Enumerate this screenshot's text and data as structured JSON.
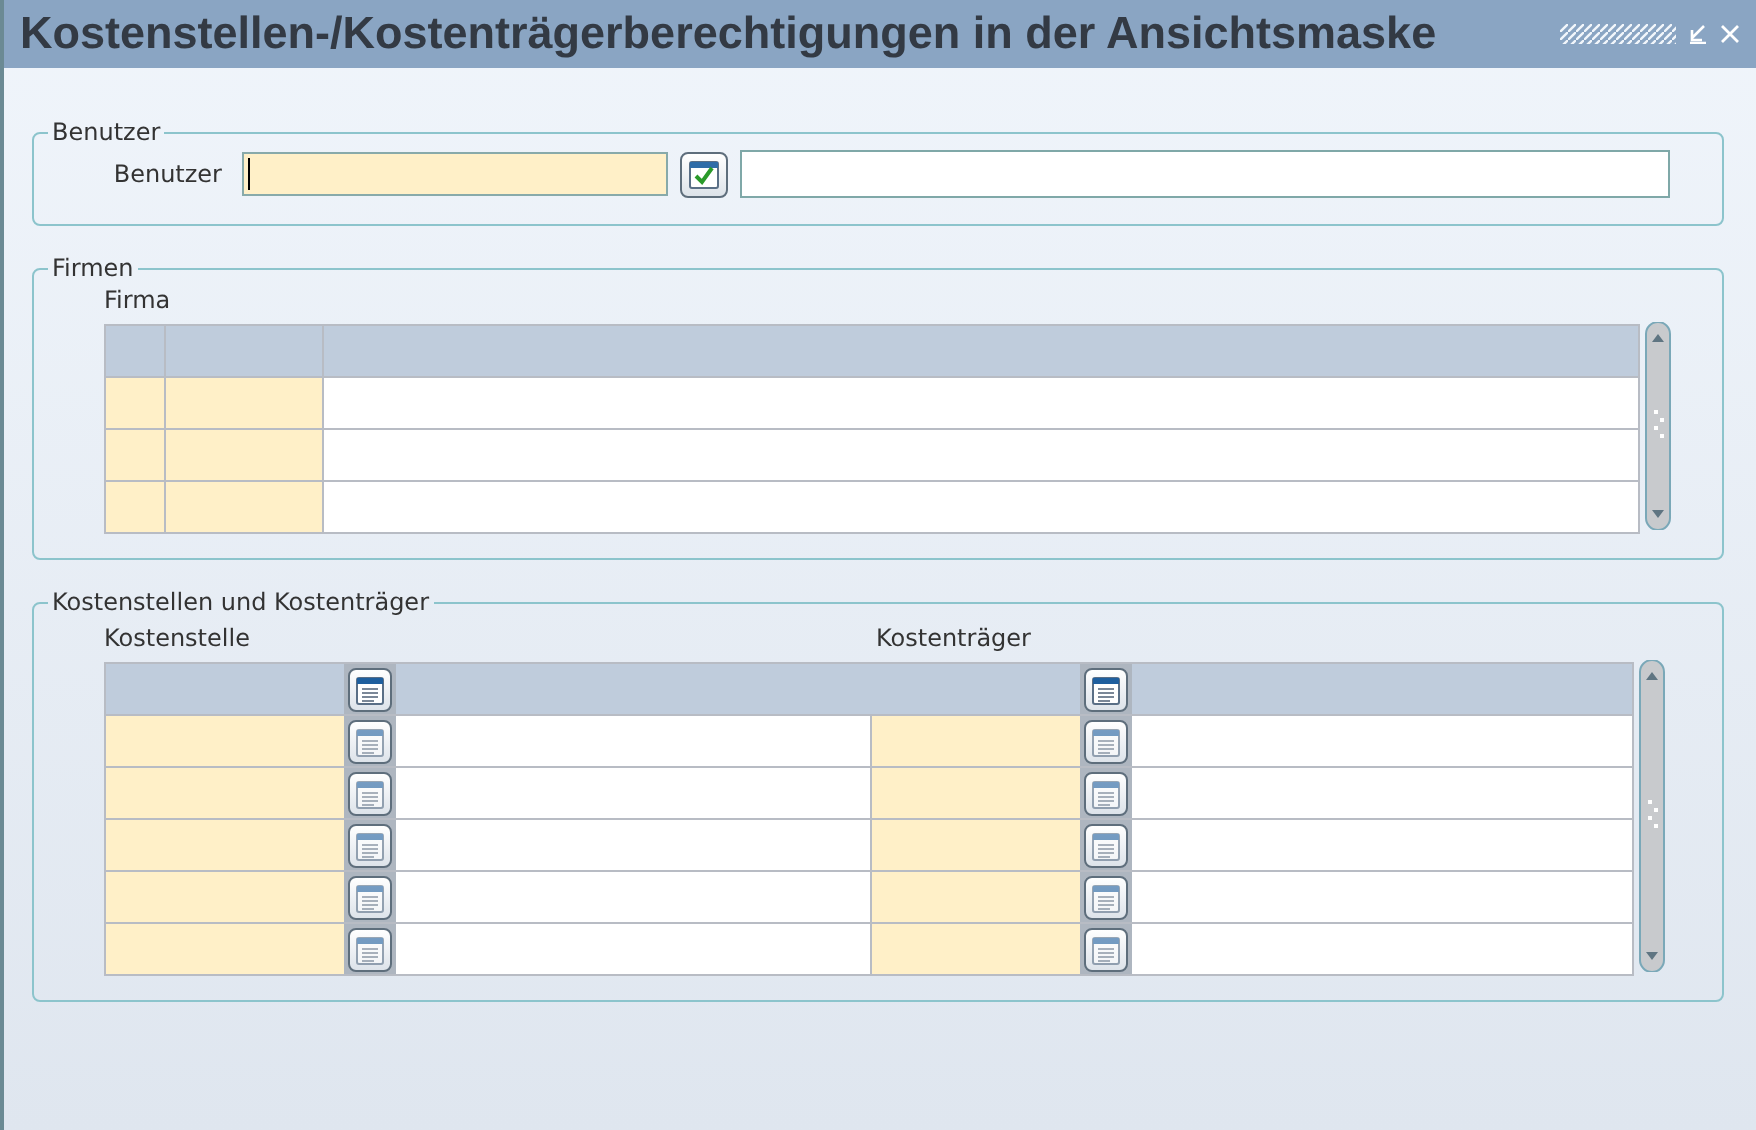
{
  "window": {
    "title": "Kostenstellen-/Kostenträgerberechtigungen in der Ansichtsmaske"
  },
  "benutzer": {
    "legend": "Benutzer",
    "label": "Benutzer",
    "field_focused": true
  },
  "firmen": {
    "legend": "Firmen",
    "column_label": "Firma"
  },
  "kosten": {
    "legend": "Kostenstellen und Kostenträger",
    "column_labels": [
      "Kostenstelle",
      "Kostenträger"
    ]
  }
}
